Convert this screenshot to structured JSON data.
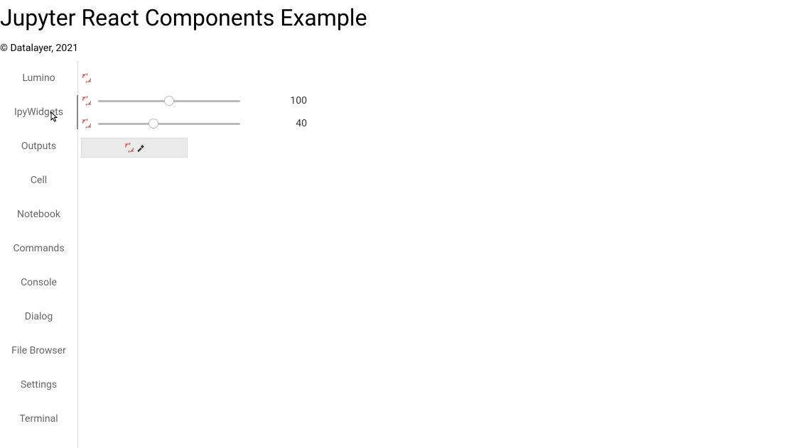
{
  "header": {
    "title": "Jupyter React Components Example",
    "copyright": "© Datalayer, 2021"
  },
  "sidebar": {
    "items": [
      {
        "label": "Lumino"
      },
      {
        "label": "IpyWidgets"
      },
      {
        "label": "Outputs"
      },
      {
        "label": "Cell"
      },
      {
        "label": "Notebook"
      },
      {
        "label": "Commands"
      },
      {
        "label": "Console"
      },
      {
        "label": "Dialog"
      },
      {
        "label": "File Browser"
      },
      {
        "label": "Settings"
      },
      {
        "label": "Terminal"
      }
    ],
    "activeIndex": 1
  },
  "widgets": {
    "sliders": [
      {
        "value": 100,
        "percent": 50
      },
      {
        "value": 40,
        "percent": 39
      }
    ]
  }
}
